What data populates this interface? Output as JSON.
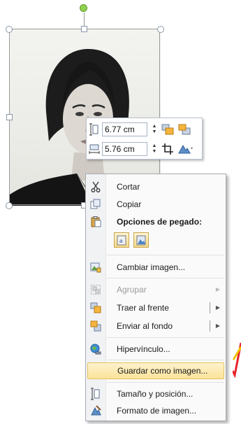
{
  "size_toolbar": {
    "height_value": "6.77 cm",
    "width_value": "5.76 cm",
    "height_icon": "shape-height-icon",
    "width_icon": "shape-width-icon",
    "bring_forward_icon": "bring-forward-icon",
    "send_backward_icon": "send-backward-icon",
    "crop_icon": "crop-icon",
    "style_icon": "picture-styles-icon",
    "spin_up": "▲",
    "spin_down": "▼"
  },
  "context_menu": {
    "items": [
      {
        "label": "Cortar",
        "icon": "cut-icon",
        "enabled": true
      },
      {
        "label": "Copiar",
        "icon": "copy-icon",
        "enabled": true
      },
      {
        "label": "Opciones de pegado:",
        "icon": "paste-icon",
        "enabled": true,
        "bold": true
      },
      {
        "label": "Cambiar imagen...",
        "icon": "change-picture-icon",
        "enabled": true
      },
      {
        "label": "Agrupar",
        "icon": "group-icon",
        "enabled": false,
        "submenu": true
      },
      {
        "label": "Traer al frente",
        "icon": "bring-to-front-icon",
        "enabled": true,
        "submenu": true
      },
      {
        "label": "Enviar al fondo",
        "icon": "send-to-back-icon",
        "enabled": true,
        "submenu": true
      },
      {
        "label": "Hipervínculo...",
        "icon": "hyperlink-icon",
        "enabled": true
      },
      {
        "label": "Guardar como imagen...",
        "icon": "",
        "enabled": true,
        "highlighted": true
      },
      {
        "label": "Tamaño y posición...",
        "icon": "size-position-icon",
        "enabled": true
      },
      {
        "label": "Formato de imagen...",
        "icon": "format-picture-icon",
        "enabled": true
      }
    ],
    "paste_options": [
      "paste-keep-text-icon",
      "paste-picture-icon"
    ],
    "submenu_arrow": "▶"
  },
  "colors": {
    "rotation_handle": "#8fd14f",
    "highlight": "#fbe39a",
    "annotation_arrow": "#e8232a"
  }
}
